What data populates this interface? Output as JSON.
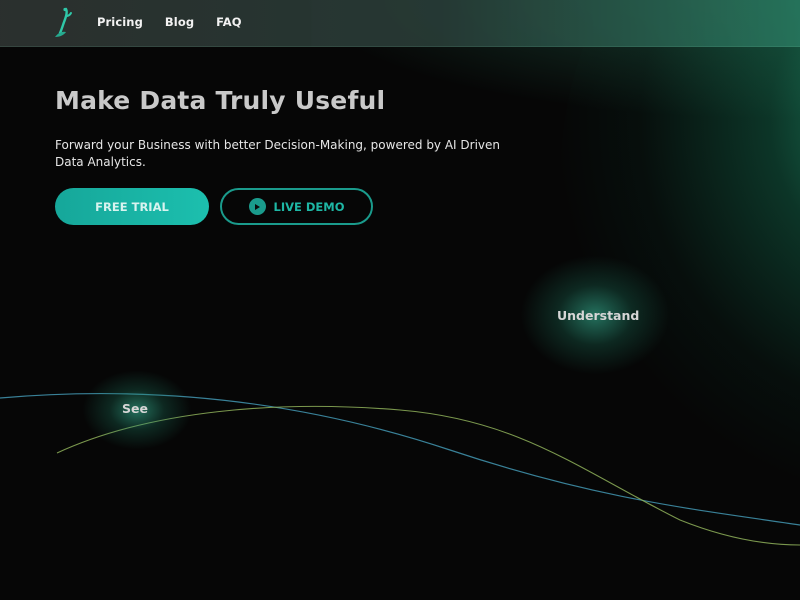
{
  "nav": {
    "items": [
      "Pricing",
      "Blog",
      "FAQ"
    ]
  },
  "hero": {
    "title": "Make Data Truly Useful",
    "subtitle": "Forward your Business with better Decision-Making, powered by AI Driven Data Analytics.",
    "primary_button": "FREE TRIAL",
    "secondary_button": "LIVE DEMO"
  },
  "orbs": {
    "understand": "Understand",
    "see": "See"
  },
  "colors": {
    "accent": "#1cbfae",
    "accent_dark": "#1a9b8c",
    "background": "#060606",
    "wave_blue": "#3f8fa8",
    "wave_green": "#8fb25a"
  },
  "icons": {
    "logo": "brush-logo-icon",
    "demo": "play-icon"
  }
}
